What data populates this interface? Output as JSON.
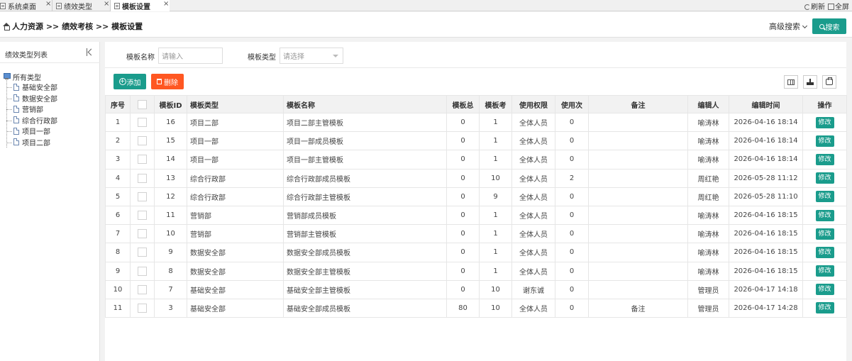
{
  "tabs": [
    {
      "label": "系统桌面",
      "active": false
    },
    {
      "label": "绩效类型",
      "active": false
    },
    {
      "label": "模板设置",
      "active": true
    }
  ],
  "toplinks": {
    "refresh": "刷新",
    "fullscreen": "全屏"
  },
  "breadcrumb": "人力资源 >> 绩效考核 >> 模板设置",
  "advanced_search": "高级搜索",
  "search_button": "搜索",
  "sidebar": {
    "title": "绩效类型列表",
    "root": "所有类型",
    "items": [
      "基础安全部",
      "数据安全部",
      "营销部",
      "综合行政部",
      "项目一部",
      "项目二部"
    ]
  },
  "filters": {
    "name_label": "模板名称",
    "name_placeholder": "请输入",
    "type_label": "模板类型",
    "type_placeholder": "请选择"
  },
  "actions": {
    "add": "添加",
    "delete": "删除"
  },
  "table": {
    "headers": [
      "序号",
      "",
      "模板ID",
      "模板类型",
      "模板名称",
      "模板总",
      "模板考",
      "使用权限",
      "使用次",
      "备注",
      "编辑人",
      "编辑时间",
      "操作"
    ],
    "edit_label": "修改",
    "rows": [
      {
        "no": "1",
        "id": "16",
        "type": "项目二部",
        "name": "项目二部主管模板",
        "total": "0",
        "exam": "1",
        "perm": "全体人员",
        "uses": "0",
        "note": "",
        "editor": "喻涛林",
        "time": "2026-04-16 18:14"
      },
      {
        "no": "2",
        "id": "15",
        "type": "项目一部",
        "name": "项目一部成员模板",
        "total": "0",
        "exam": "1",
        "perm": "全体人员",
        "uses": "0",
        "note": "",
        "editor": "喻涛林",
        "time": "2026-04-16 18:14"
      },
      {
        "no": "3",
        "id": "14",
        "type": "项目一部",
        "name": "项目一部主管模板",
        "total": "0",
        "exam": "1",
        "perm": "全体人员",
        "uses": "0",
        "note": "",
        "editor": "喻涛林",
        "time": "2026-04-16 18:14"
      },
      {
        "no": "4",
        "id": "13",
        "type": "综合行政部",
        "name": "综合行政部成员模板",
        "total": "0",
        "exam": "10",
        "perm": "全体人员",
        "uses": "2",
        "note": "",
        "editor": "周红艳",
        "time": "2026-05-28 11:12"
      },
      {
        "no": "5",
        "id": "12",
        "type": "综合行政部",
        "name": "综合行政部主管模板",
        "total": "0",
        "exam": "9",
        "perm": "全体人员",
        "uses": "0",
        "note": "",
        "editor": "周红艳",
        "time": "2026-05-28 11:10"
      },
      {
        "no": "6",
        "id": "11",
        "type": "营销部",
        "name": "营销部成员模板",
        "total": "0",
        "exam": "1",
        "perm": "全体人员",
        "uses": "0",
        "note": "",
        "editor": "喻涛林",
        "time": "2026-04-16 18:15"
      },
      {
        "no": "7",
        "id": "10",
        "type": "营销部",
        "name": "营销部主管模板",
        "total": "0",
        "exam": "1",
        "perm": "全体人员",
        "uses": "0",
        "note": "",
        "editor": "喻涛林",
        "time": "2026-04-16 18:15"
      },
      {
        "no": "8",
        "id": "9",
        "type": "数据安全部",
        "name": "数据安全部成员模板",
        "total": "0",
        "exam": "1",
        "perm": "全体人员",
        "uses": "0",
        "note": "",
        "editor": "喻涛林",
        "time": "2026-04-16 18:15"
      },
      {
        "no": "9",
        "id": "8",
        "type": "数据安全部",
        "name": "数据安全部主管模板",
        "total": "0",
        "exam": "1",
        "perm": "全体人员",
        "uses": "0",
        "note": "",
        "editor": "喻涛林",
        "time": "2026-04-16 18:15"
      },
      {
        "no": "10",
        "id": "7",
        "type": "基础安全部",
        "name": "基础安全部主管模板",
        "total": "0",
        "exam": "10",
        "perm": "谢东诚",
        "uses": "0",
        "note": "",
        "editor": "管理员",
        "time": "2026-04-17 14:18"
      },
      {
        "no": "11",
        "id": "3",
        "type": "基础安全部",
        "name": "基础安全部成员模板",
        "total": "80",
        "exam": "10",
        "perm": "全体人员",
        "uses": "0",
        "note": "备注",
        "editor": "管理员",
        "time": "2026-04-17 14:28"
      }
    ]
  },
  "colors": {
    "accent": "#1a9c8c",
    "danger": "#ff5722"
  }
}
